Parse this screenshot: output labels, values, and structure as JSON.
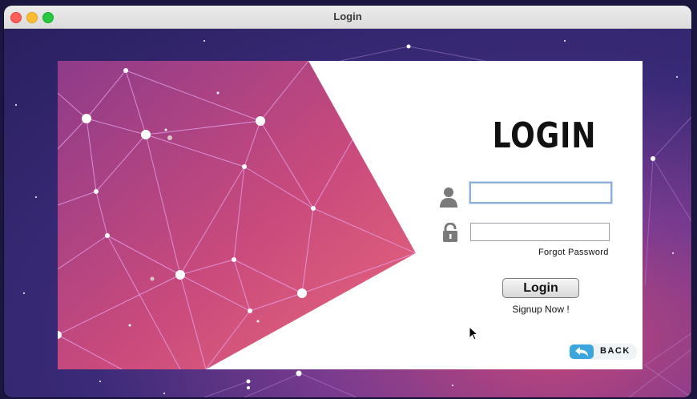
{
  "window": {
    "title": "Login"
  },
  "form": {
    "heading": "LOGIN",
    "username": {
      "value": "",
      "placeholder": ""
    },
    "password": {
      "value": "",
      "placeholder": ""
    },
    "forgot_password": "Forgot Password",
    "login_button": "Login",
    "signup_link": "Signup Now !",
    "back_button": "BACK"
  },
  "colors": {
    "accent_back": "#3aa6dd",
    "art_pink": "#d9577f",
    "art_purple": "#8e3b8a"
  },
  "icons": [
    "user-icon",
    "lock-icon",
    "back-arrow-icon"
  ]
}
